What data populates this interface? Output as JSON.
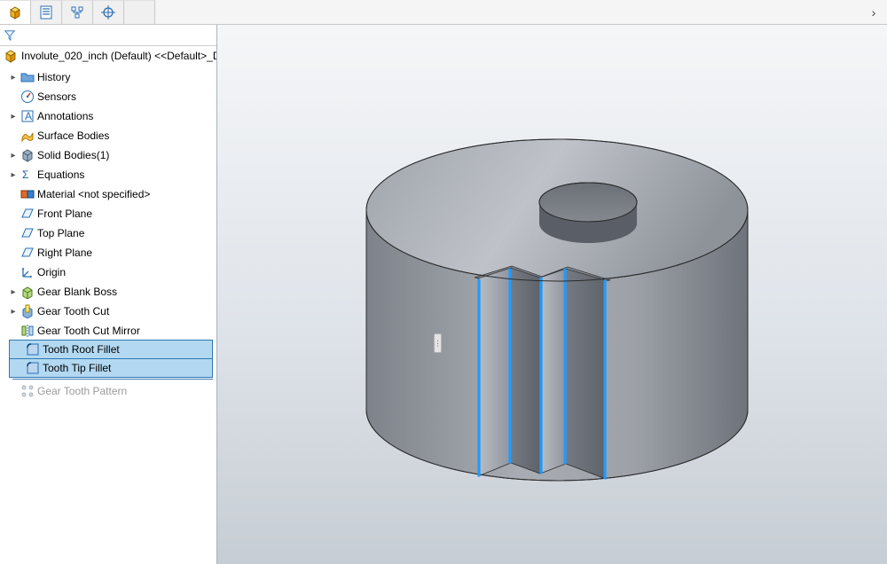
{
  "tabs": {
    "count": 5
  },
  "root_label": "Involute_020_inch (Default) <<Default>_D",
  "tree": {
    "history": "History",
    "sensors": "Sensors",
    "annotations": "Annotations",
    "surface_bodies": "Surface Bodies",
    "solid_bodies": "Solid Bodies(1)",
    "equations": "Equations",
    "material": "Material <not specified>",
    "front_plane": "Front Plane",
    "top_plane": "Top Plane",
    "right_plane": "Right Plane",
    "origin": "Origin",
    "gear_blank": "Gear Blank Boss",
    "gear_tooth_cut": "Gear Tooth Cut",
    "gear_tooth_mirror": "Gear Tooth Cut Mirror",
    "tooth_root_fillet": "Tooth Root Fillet",
    "tooth_tip_fillet": "Tooth Tip Fillet",
    "gear_tooth_pattern": "Gear Tooth Pattern"
  },
  "chevron_glyph": "›"
}
